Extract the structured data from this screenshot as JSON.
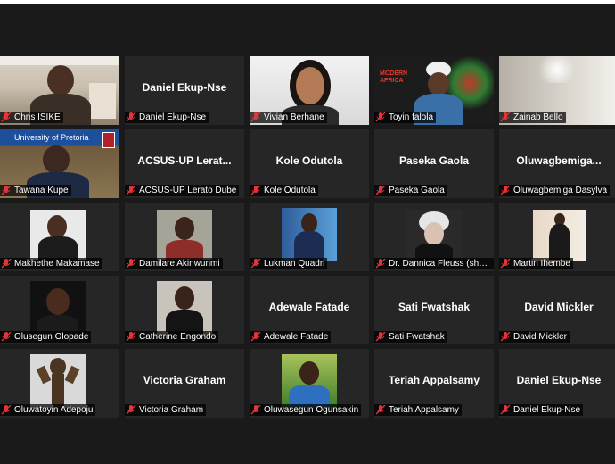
{
  "colors": {
    "background": "#1a1a1a",
    "tile": "#262626",
    "active_border": "#9fd34a",
    "muted_mic": "#e5343a"
  },
  "icons": {
    "muted": "mic-muted-icon"
  },
  "participants": [
    {
      "name": "Chris ISIKE",
      "video": true,
      "active": true
    },
    {
      "name": "Daniel Ekup-Nse",
      "video": false,
      "center": "Daniel Ekup-Nse"
    },
    {
      "name": "Vivian Berhane",
      "video": true
    },
    {
      "name": "Toyin falola",
      "video": true,
      "poster": "MODERN AFRICA"
    },
    {
      "name": "Zainab Bello",
      "video": true
    },
    {
      "name": "Tawana Kupe",
      "video": true,
      "banner": "University of Pretoria"
    },
    {
      "name": "ACSUS-UP Lerato Dube",
      "video": false,
      "center": "ACSUS-UP  Lerat..."
    },
    {
      "name": "Kole Odutola",
      "video": false,
      "center": "Kole Odutola"
    },
    {
      "name": "Paseka Gaola",
      "video": false,
      "center": "Paseka Gaola"
    },
    {
      "name": "Oluwagbemiga Dasylva",
      "video": false,
      "center": "Oluwagbemiga..."
    },
    {
      "name": "Makhethe Makamase",
      "video": true
    },
    {
      "name": "Damilare Akinwunmi",
      "video": true
    },
    {
      "name": "Lukman Quadri",
      "video": true
    },
    {
      "name": "Dr. Dannica Fleuss (she/...",
      "video": true
    },
    {
      "name": "Martin Ihembe",
      "video": true
    },
    {
      "name": "Olusegun Olopade",
      "video": true
    },
    {
      "name": "Catherine Engondo",
      "video": true
    },
    {
      "name": "Adewale Fatade",
      "video": false,
      "center": "Adewale Fatade"
    },
    {
      "name": "Sati Fwatshak",
      "video": false,
      "center": "Sati Fwatshak"
    },
    {
      "name": "David Mickler",
      "video": false,
      "center": "David Mickler"
    },
    {
      "name": "Oluwatoyin Adepoju",
      "video": true
    },
    {
      "name": "Victoria Graham",
      "video": false,
      "center": "Victoria Graham"
    },
    {
      "name": "Oluwasegun Ogunsakin",
      "video": true
    },
    {
      "name": "Teriah Appalsamy",
      "video": false,
      "center": "Teriah Appalsamy"
    },
    {
      "name": "Daniel Ekup-Nse",
      "video": false,
      "center": "Daniel Ekup-Nse"
    }
  ]
}
